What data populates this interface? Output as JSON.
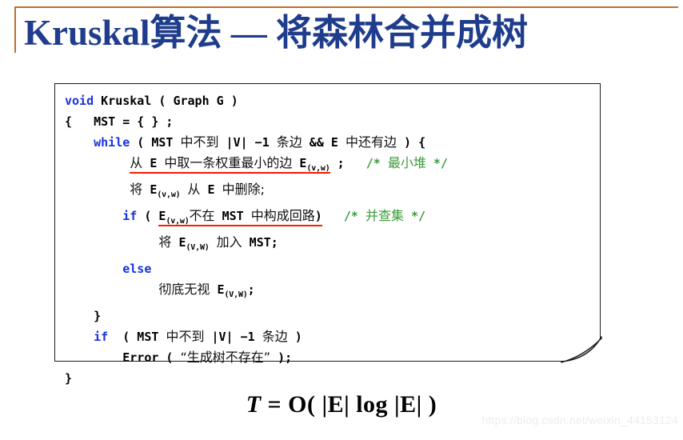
{
  "slide": {
    "title": "Kruskal算法 — 将森林合并成树",
    "title_color": "#1F3D8C",
    "frame_color": "#C0702A",
    "background": "#ffffff"
  },
  "code_box": {
    "border_color": "#1a1a1a",
    "keyword_color": "#1733E0",
    "comment_color": "#3B9B3B",
    "underline_color": "#FF1A00",
    "lines": [
      {
        "id": "line-1",
        "text": "void Kruskal ( Graph G )"
      },
      {
        "id": "line-2",
        "text": "{   MST = { } ;"
      },
      {
        "id": "line-3",
        "text": "    while ( MST 中不到 |V| −1 条边 && E 中还有边 ) {"
      },
      {
        "id": "line-4",
        "text": "        从 E 中取一条权重最小的边 E(v,w) ;    /* 最小堆 */"
      },
      {
        "id": "line-5",
        "text": "        将 E(v,w) 从 E 中删除;"
      },
      {
        "id": "line-6",
        "text": "        if ( E(v,w)不在 MST 中构成回路)    /* 并查集 */"
      },
      {
        "id": "line-7",
        "text": "            将 E(V,W) 加入 MST;"
      },
      {
        "id": "line-8",
        "text": "        else"
      },
      {
        "id": "line-9",
        "text": "            彻底无视 E(V,W);"
      },
      {
        "id": "line-10",
        "text": "    }"
      },
      {
        "id": "line-11",
        "text": "    if  ( MST 中不到 |V| −1 条边 )"
      },
      {
        "id": "line-12",
        "text": "        Error ( “生成树不存在” );"
      },
      {
        "id": "line-13",
        "text": "}"
      }
    ],
    "keywords": [
      "void",
      "while",
      "if",
      "else"
    ],
    "comments": [
      "/* 最小堆 */",
      "/* 并查集 */"
    ],
    "underlined_fragments": [
      "从 E 中取一条权重最小的边 E(v,w)",
      "E(v,w)不在 MST 中构成回路"
    ]
  },
  "complexity": {
    "symbol": "T",
    "equals": " = ",
    "expression": "O( |E| log |E| )",
    "full": "T = O( |E| log |E| )"
  },
  "watermark": {
    "text": "https://blog.csdn.net/weixin_44153124"
  }
}
